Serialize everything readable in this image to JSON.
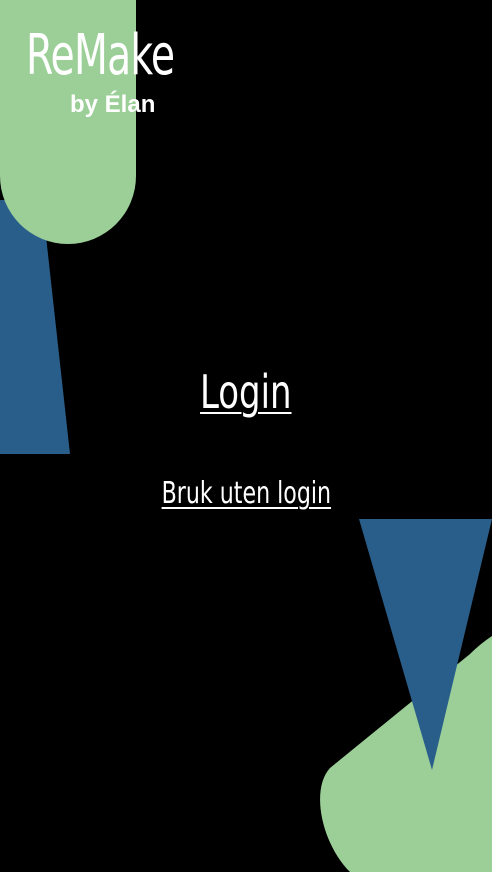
{
  "brand": {
    "name": "ReMake",
    "byline": "by Élan"
  },
  "actions": {
    "login_label": "Login",
    "guest_label": "Bruk uten login"
  },
  "colors": {
    "background": "#000000",
    "accent_green": "#9bcf97",
    "accent_blue": "#2a5e8a",
    "text": "#ffffff"
  }
}
